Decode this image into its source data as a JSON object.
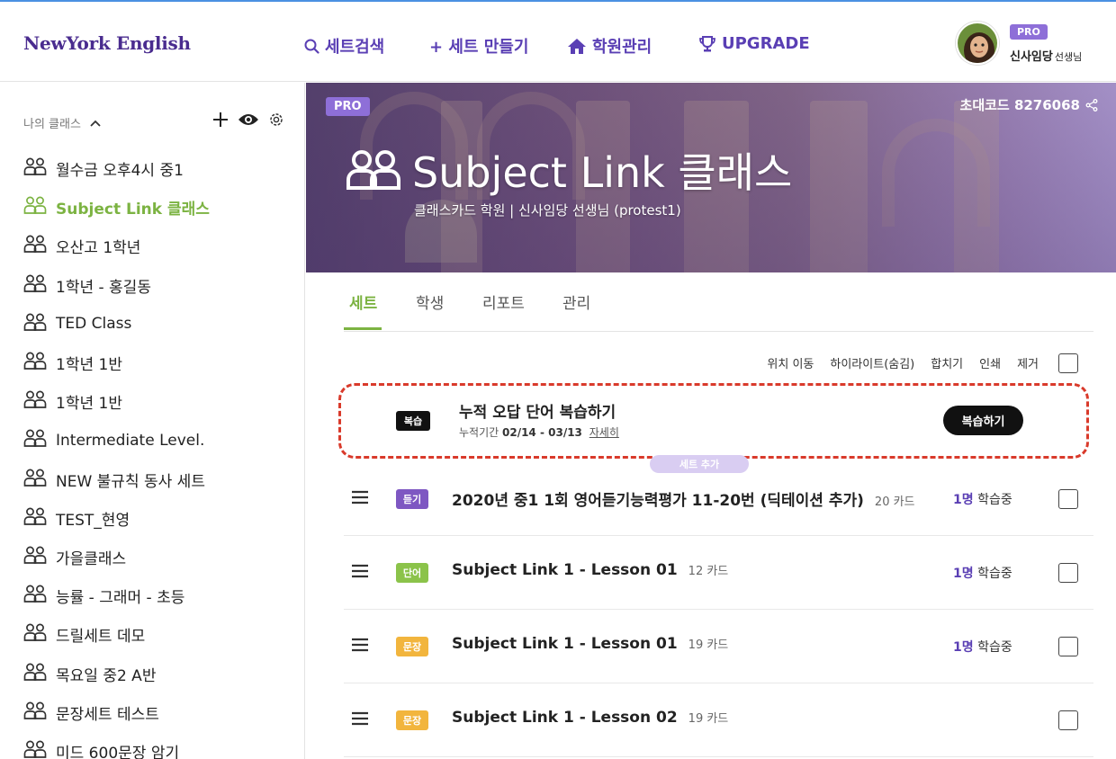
{
  "header": {
    "logo": "NewYork English",
    "nav": {
      "search": "세트검색",
      "create": "+ 세트 만들기",
      "academy": "학원관리",
      "upgrade": "UPGRADE"
    },
    "user": {
      "badge": "PRO",
      "name": "신사임당",
      "suffix": "선생님"
    }
  },
  "sidebar": {
    "heading": "나의 클래스",
    "items": [
      {
        "label": "월수금 오후4시 중1"
      },
      {
        "label": "Subject Link 클래스",
        "active": true
      },
      {
        "label": "오산고 1학년"
      },
      {
        "label": "1학년 - 홍길동"
      },
      {
        "label": "TED Class"
      },
      {
        "label": "1학년 1반"
      },
      {
        "label": "1학년 1반"
      },
      {
        "label": "Intermediate Level."
      },
      {
        "label": "NEW 불규칙 동사 세트"
      },
      {
        "label": "TEST_현영"
      },
      {
        "label": "가을클래스"
      },
      {
        "label": "능률 - 그래머 - 초등"
      },
      {
        "label": "드릴세트 데모"
      },
      {
        "label": "목요일 중2 A반"
      },
      {
        "label": "문장세트 테스트"
      },
      {
        "label": "미드 600문장 암기"
      }
    ]
  },
  "banner": {
    "badge": "PRO",
    "invite_code": "초대코드 8276068",
    "title": "Subject Link 클래스",
    "subtitle": "클래스카드 학원 | 신사임당 선생님 (protest1)"
  },
  "tabs": [
    {
      "label": "세트",
      "active": true
    },
    {
      "label": "학생"
    },
    {
      "label": "리포트"
    },
    {
      "label": "관리"
    }
  ],
  "actions": [
    "위치 이동",
    "하이라이트(숨김)",
    "합치기",
    "인쇄",
    "제거"
  ],
  "review": {
    "tag": "복습",
    "title": "누적 오답 단어 복습하기",
    "period_label": "누적기간",
    "period": "02/14 - 03/13",
    "detail_link": "자세히",
    "button": "복습하기"
  },
  "add_set_label": "세트 추가",
  "sets": [
    {
      "tag": "듣기",
      "tag_color": "#7e57c2",
      "title": "2020년 중1 1회 영어듣기능력평가 11-20번 (딕테이션 추가)",
      "cards": "20 카드",
      "learners_count": "1명",
      "learners_label": "학습중"
    },
    {
      "tag": "단어",
      "tag_color": "#8bc34a",
      "title": "Subject Link 1 - Lesson 01",
      "cards": "12 카드",
      "learners_count": "1명",
      "learners_label": "학습중"
    },
    {
      "tag": "문장",
      "tag_color": "#f2b53d",
      "title": "Subject Link 1 - Lesson 01",
      "cards": "19 카드",
      "learners_count": "1명",
      "learners_label": "학습중"
    },
    {
      "tag": "문장",
      "tag_color": "#f2b53d",
      "title": "Subject Link 1 - Lesson 02",
      "cards": "19 카드",
      "learners_count": "",
      "learners_label": ""
    }
  ],
  "colors": {
    "brand_purple": "#5a3fb4",
    "active_green": "#7cb342",
    "pro_badge": "#8e6fd8",
    "review_outline": "#d93a2b"
  }
}
